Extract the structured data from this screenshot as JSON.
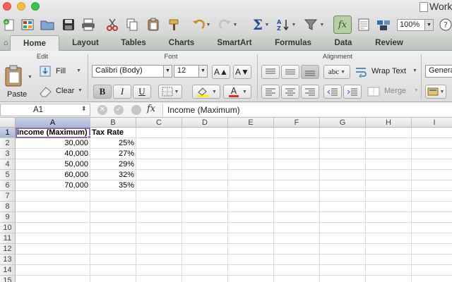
{
  "window": {
    "title": "Work"
  },
  "toolbar": {
    "zoom": "100%"
  },
  "tabs": [
    "Home",
    "Layout",
    "Tables",
    "Charts",
    "SmartArt",
    "Formulas",
    "Data",
    "Review"
  ],
  "ribbon": {
    "groups": {
      "edit": "Edit",
      "font": "Font",
      "alignment": "Alignment"
    },
    "paste": "Paste",
    "fill": "Fill",
    "clear": "Clear",
    "font_name": "Calibri (Body)",
    "font_size": "12",
    "bold": "B",
    "italic": "I",
    "underline": "U",
    "wrap_text": "Wrap Text",
    "merge": "Merge",
    "number_format": "Genera",
    "abc": "abc"
  },
  "formula_bar": {
    "name_box": "A1",
    "fx": "fx",
    "content": "Income (Maximum)"
  },
  "sheet": {
    "columns": [
      "A",
      "B",
      "C",
      "D",
      "E",
      "F",
      "G",
      "H",
      "I"
    ],
    "rows": [
      "1",
      "2",
      "3",
      "4",
      "5",
      "6",
      "7",
      "8",
      "9",
      "10",
      "11",
      "12",
      "13",
      "14",
      "15"
    ],
    "headers": [
      "Income (Maximum)",
      "Tax Rate"
    ],
    "data": [
      [
        "30,000",
        "25%"
      ],
      [
        "40,000",
        "27%"
      ],
      [
        "50,000",
        "29%"
      ],
      [
        "60,000",
        "32%"
      ],
      [
        "70,000",
        "35%"
      ]
    ]
  }
}
